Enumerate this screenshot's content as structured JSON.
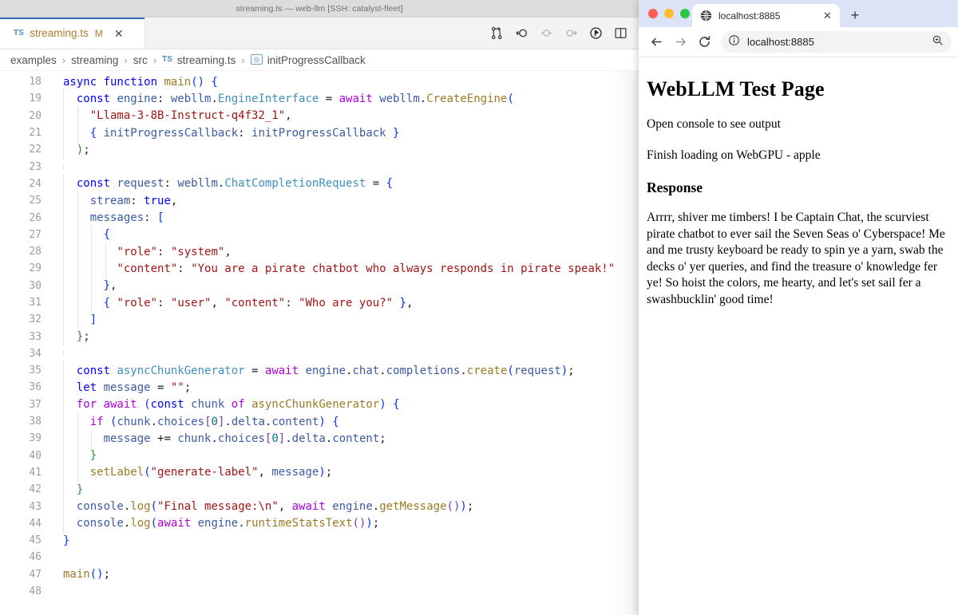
{
  "editor": {
    "window_title": "streaming.ts — web-llm [SSH: catalyst-fleet]",
    "tab": {
      "lang_badge": "TS",
      "filename": "streaming.ts",
      "modified_badge": "M",
      "close_label": "✕"
    },
    "toolbar_icons": [
      "split-changes-icon",
      "previous-change-icon",
      "step-over-icon",
      "step-into-icon",
      "run-icon",
      "split-editor-icon"
    ],
    "breadcrumb": {
      "items": [
        "examples",
        "streaming",
        "src",
        "streaming.ts",
        "initProgressCallback"
      ],
      "separator": "›",
      "file_badge": "TS",
      "symbol_badge": "⬡"
    },
    "first_line_number": 18,
    "lines": [
      {
        "n": 18,
        "guides": 0,
        "tokens": [
          {
            "t": "async ",
            "c": "t-kw"
          },
          {
            "t": "function ",
            "c": "t-kw"
          },
          {
            "t": "main",
            "c": "t-fn"
          },
          {
            "t": "(",
            "c": "b-blue"
          },
          {
            "t": ")",
            "c": "b-blue"
          },
          {
            "t": " ",
            "c": "t-plain"
          },
          {
            "t": "{",
            "c": "b-blue"
          }
        ]
      },
      {
        "n": 19,
        "guides": 1,
        "tokens": [
          {
            "t": "  ",
            "c": "t-plain"
          },
          {
            "t": "const ",
            "c": "t-kw"
          },
          {
            "t": "engine",
            "c": "t-var"
          },
          {
            "t": ": ",
            "c": "t-plain"
          },
          {
            "t": "webllm",
            "c": "t-var"
          },
          {
            "t": ".",
            "c": "t-plain"
          },
          {
            "t": "EngineInterface",
            "c": "t-type"
          },
          {
            "t": " = ",
            "c": "t-plain"
          },
          {
            "t": "await ",
            "c": "t-ctl"
          },
          {
            "t": "webllm",
            "c": "t-var"
          },
          {
            "t": ".",
            "c": "t-plain"
          },
          {
            "t": "CreateEngine",
            "c": "t-fn"
          },
          {
            "t": "(",
            "c": "b-blue"
          }
        ]
      },
      {
        "n": 20,
        "guides": 2,
        "tokens": [
          {
            "t": "    ",
            "c": "t-plain"
          },
          {
            "t": "\"Llama-3-8B-Instruct-q4f32_1\"",
            "c": "t-str"
          },
          {
            "t": ",",
            "c": "t-plain"
          }
        ]
      },
      {
        "n": 21,
        "guides": 2,
        "tokens": [
          {
            "t": "    ",
            "c": "t-plain"
          },
          {
            "t": "{",
            "c": "b-blue"
          },
          {
            "t": " ",
            "c": "t-plain"
          },
          {
            "t": "initProgressCallback",
            "c": "t-var"
          },
          {
            "t": ": ",
            "c": "t-plain"
          },
          {
            "t": "initProgressCallback",
            "c": "t-var"
          },
          {
            "t": " ",
            "c": "t-plain"
          },
          {
            "t": "}",
            "c": "b-blue"
          }
        ]
      },
      {
        "n": 22,
        "guides": 1,
        "tokens": [
          {
            "t": "  ",
            "c": "t-plain"
          },
          {
            "t": ")",
            "c": "b-green"
          },
          {
            "t": ";",
            "c": "t-plain"
          }
        ]
      },
      {
        "n": 23,
        "guides": 1,
        "tokens": []
      },
      {
        "n": 24,
        "guides": 1,
        "tokens": [
          {
            "t": "  ",
            "c": "t-plain"
          },
          {
            "t": "const ",
            "c": "t-kw"
          },
          {
            "t": "request",
            "c": "t-var"
          },
          {
            "t": ": ",
            "c": "t-plain"
          },
          {
            "t": "webllm",
            "c": "t-var"
          },
          {
            "t": ".",
            "c": "t-plain"
          },
          {
            "t": "ChatCompletionRequest",
            "c": "t-type"
          },
          {
            "t": " = ",
            "c": "t-plain"
          },
          {
            "t": "{",
            "c": "b-blue"
          }
        ]
      },
      {
        "n": 25,
        "guides": 2,
        "tokens": [
          {
            "t": "    ",
            "c": "t-plain"
          },
          {
            "t": "stream",
            "c": "t-var"
          },
          {
            "t": ": ",
            "c": "t-plain"
          },
          {
            "t": "true",
            "c": "t-kw"
          },
          {
            "t": ",",
            "c": "t-plain"
          }
        ]
      },
      {
        "n": 26,
        "guides": 2,
        "tokens": [
          {
            "t": "    ",
            "c": "t-plain"
          },
          {
            "t": "messages",
            "c": "t-var"
          },
          {
            "t": ": ",
            "c": "t-plain"
          },
          {
            "t": "[",
            "c": "b-blue"
          }
        ]
      },
      {
        "n": 27,
        "guides": 3,
        "tokens": [
          {
            "t": "      ",
            "c": "t-plain"
          },
          {
            "t": "{",
            "c": "b-blue"
          }
        ]
      },
      {
        "n": 28,
        "guides": 4,
        "tokens": [
          {
            "t": "        ",
            "c": "t-plain"
          },
          {
            "t": "\"role\"",
            "c": "t-str"
          },
          {
            "t": ": ",
            "c": "t-plain"
          },
          {
            "t": "\"system\"",
            "c": "t-str"
          },
          {
            "t": ",",
            "c": "t-plain"
          }
        ]
      },
      {
        "n": 29,
        "guides": 4,
        "tokens": [
          {
            "t": "        ",
            "c": "t-plain"
          },
          {
            "t": "\"content\"",
            "c": "t-str"
          },
          {
            "t": ": ",
            "c": "t-plain"
          },
          {
            "t": "\"You are a pirate chatbot who always responds in pirate speak!\"",
            "c": "t-str"
          }
        ]
      },
      {
        "n": 30,
        "guides": 3,
        "tokens": [
          {
            "t": "      ",
            "c": "t-plain"
          },
          {
            "t": "}",
            "c": "b-blue"
          },
          {
            "t": ",",
            "c": "t-plain"
          }
        ]
      },
      {
        "n": 31,
        "guides": 3,
        "tokens": [
          {
            "t": "      ",
            "c": "t-plain"
          },
          {
            "t": "{",
            "c": "b-blue"
          },
          {
            "t": " ",
            "c": "t-plain"
          },
          {
            "t": "\"role\"",
            "c": "t-str"
          },
          {
            "t": ": ",
            "c": "t-plain"
          },
          {
            "t": "\"user\"",
            "c": "t-str"
          },
          {
            "t": ", ",
            "c": "t-plain"
          },
          {
            "t": "\"content\"",
            "c": "t-str"
          },
          {
            "t": ": ",
            "c": "t-plain"
          },
          {
            "t": "\"Who are you?\"",
            "c": "t-str"
          },
          {
            "t": " ",
            "c": "t-plain"
          },
          {
            "t": "}",
            "c": "b-blue"
          },
          {
            "t": ",",
            "c": "t-plain"
          }
        ]
      },
      {
        "n": 32,
        "guides": 2,
        "tokens": [
          {
            "t": "    ",
            "c": "t-plain"
          },
          {
            "t": "]",
            "c": "b-blue"
          }
        ]
      },
      {
        "n": 33,
        "guides": 1,
        "tokens": [
          {
            "t": "  ",
            "c": "t-plain"
          },
          {
            "t": "}",
            "c": "b-green"
          },
          {
            "t": ";",
            "c": "t-plain"
          }
        ]
      },
      {
        "n": 34,
        "guides": 1,
        "tokens": []
      },
      {
        "n": 35,
        "guides": 1,
        "tokens": [
          {
            "t": "  ",
            "c": "t-plain"
          },
          {
            "t": "const ",
            "c": "t-kw"
          },
          {
            "t": "asyncChunkGenerator",
            "c": "t-type"
          },
          {
            "t": " = ",
            "c": "t-plain"
          },
          {
            "t": "await ",
            "c": "t-ctl"
          },
          {
            "t": "engine",
            "c": "t-var"
          },
          {
            "t": ".",
            "c": "t-plain"
          },
          {
            "t": "chat",
            "c": "t-var"
          },
          {
            "t": ".",
            "c": "t-plain"
          },
          {
            "t": "completions",
            "c": "t-var"
          },
          {
            "t": ".",
            "c": "t-plain"
          },
          {
            "t": "create",
            "c": "t-fn"
          },
          {
            "t": "(",
            "c": "b-blue"
          },
          {
            "t": "request",
            "c": "t-var"
          },
          {
            "t": ")",
            "c": "b-blue"
          },
          {
            "t": ";",
            "c": "t-plain"
          }
        ]
      },
      {
        "n": 36,
        "guides": 1,
        "tokens": [
          {
            "t": "  ",
            "c": "t-plain"
          },
          {
            "t": "let ",
            "c": "t-kw"
          },
          {
            "t": "message",
            "c": "t-var"
          },
          {
            "t": " = ",
            "c": "t-plain"
          },
          {
            "t": "\"\"",
            "c": "t-str"
          },
          {
            "t": ";",
            "c": "t-plain"
          }
        ]
      },
      {
        "n": 37,
        "guides": 1,
        "tokens": [
          {
            "t": "  ",
            "c": "t-plain"
          },
          {
            "t": "for ",
            "c": "t-ctl"
          },
          {
            "t": "await ",
            "c": "t-ctl"
          },
          {
            "t": "(",
            "c": "b-blue"
          },
          {
            "t": "const ",
            "c": "t-kw"
          },
          {
            "t": "chunk",
            "c": "t-var"
          },
          {
            "t": " ",
            "c": "t-plain"
          },
          {
            "t": "of ",
            "c": "t-ctl"
          },
          {
            "t": "asyncChunkGenerator",
            "c": "t-fn"
          },
          {
            "t": ")",
            "c": "b-blue"
          },
          {
            "t": " ",
            "c": "t-plain"
          },
          {
            "t": "{",
            "c": "b-blue"
          }
        ]
      },
      {
        "n": 38,
        "guides": 2,
        "tokens": [
          {
            "t": "    ",
            "c": "t-plain"
          },
          {
            "t": "if ",
            "c": "t-ctl"
          },
          {
            "t": "(",
            "c": "b-blue"
          },
          {
            "t": "chunk",
            "c": "t-var"
          },
          {
            "t": ".",
            "c": "t-plain"
          },
          {
            "t": "choices",
            "c": "t-var"
          },
          {
            "t": "[",
            "c": "b-purp"
          },
          {
            "t": "0",
            "c": "t-num"
          },
          {
            "t": "]",
            "c": "b-purp"
          },
          {
            "t": ".",
            "c": "t-plain"
          },
          {
            "t": "delta",
            "c": "t-var"
          },
          {
            "t": ".",
            "c": "t-plain"
          },
          {
            "t": "content",
            "c": "t-var"
          },
          {
            "t": ")",
            "c": "b-blue"
          },
          {
            "t": " ",
            "c": "t-plain"
          },
          {
            "t": "{",
            "c": "b-blue"
          }
        ]
      },
      {
        "n": 39,
        "guides": 3,
        "tokens": [
          {
            "t": "      ",
            "c": "t-plain"
          },
          {
            "t": "message",
            "c": "t-var"
          },
          {
            "t": " += ",
            "c": "t-plain"
          },
          {
            "t": "chunk",
            "c": "t-var"
          },
          {
            "t": ".",
            "c": "t-plain"
          },
          {
            "t": "choices",
            "c": "t-var"
          },
          {
            "t": "[",
            "c": "b-purp"
          },
          {
            "t": "0",
            "c": "t-num"
          },
          {
            "t": "]",
            "c": "b-purp"
          },
          {
            "t": ".",
            "c": "t-plain"
          },
          {
            "t": "delta",
            "c": "t-var"
          },
          {
            "t": ".",
            "c": "t-plain"
          },
          {
            "t": "content",
            "c": "t-var"
          },
          {
            "t": ";",
            "c": "t-plain"
          }
        ]
      },
      {
        "n": 40,
        "guides": 2,
        "tokens": [
          {
            "t": "    ",
            "c": "t-plain"
          },
          {
            "t": "}",
            "c": "b-green"
          }
        ]
      },
      {
        "n": 41,
        "guides": 2,
        "tokens": [
          {
            "t": "    ",
            "c": "t-plain"
          },
          {
            "t": "setLabel",
            "c": "t-fn"
          },
          {
            "t": "(",
            "c": "b-blue"
          },
          {
            "t": "\"generate-label\"",
            "c": "t-str"
          },
          {
            "t": ", ",
            "c": "t-plain"
          },
          {
            "t": "message",
            "c": "t-var"
          },
          {
            "t": ")",
            "c": "b-blue"
          },
          {
            "t": ";",
            "c": "t-plain"
          }
        ]
      },
      {
        "n": 42,
        "guides": 1,
        "tokens": [
          {
            "t": "  ",
            "c": "t-plain"
          },
          {
            "t": "}",
            "c": "b-green"
          }
        ]
      },
      {
        "n": 43,
        "guides": 1,
        "tokens": [
          {
            "t": "  ",
            "c": "t-plain"
          },
          {
            "t": "console",
            "c": "t-var"
          },
          {
            "t": ".",
            "c": "t-plain"
          },
          {
            "t": "log",
            "c": "t-fn"
          },
          {
            "t": "(",
            "c": "b-blue"
          },
          {
            "t": "\"Final message:\\n\"",
            "c": "t-str"
          },
          {
            "t": ", ",
            "c": "t-plain"
          },
          {
            "t": "await ",
            "c": "t-ctl"
          },
          {
            "t": "engine",
            "c": "t-var"
          },
          {
            "t": ".",
            "c": "t-plain"
          },
          {
            "t": "getMessage",
            "c": "t-fn"
          },
          {
            "t": "(",
            "c": "b-purp"
          },
          {
            "t": ")",
            "c": "b-purp"
          },
          {
            "t": ")",
            "c": "b-blue"
          },
          {
            "t": ";",
            "c": "t-plain"
          }
        ]
      },
      {
        "n": 44,
        "guides": 1,
        "tokens": [
          {
            "t": "  ",
            "c": "t-plain"
          },
          {
            "t": "console",
            "c": "t-var"
          },
          {
            "t": ".",
            "c": "t-plain"
          },
          {
            "t": "log",
            "c": "t-fn"
          },
          {
            "t": "(",
            "c": "b-blue"
          },
          {
            "t": "await ",
            "c": "t-ctl"
          },
          {
            "t": "engine",
            "c": "t-var"
          },
          {
            "t": ".",
            "c": "t-plain"
          },
          {
            "t": "runtimeStatsText",
            "c": "t-fn"
          },
          {
            "t": "(",
            "c": "b-purp"
          },
          {
            "t": ")",
            "c": "b-purp"
          },
          {
            "t": ")",
            "c": "b-blue"
          },
          {
            "t": ";",
            "c": "t-plain"
          }
        ]
      },
      {
        "n": 45,
        "guides": 0,
        "tokens": [
          {
            "t": "}",
            "c": "b-blue"
          }
        ]
      },
      {
        "n": 46,
        "guides": 0,
        "tokens": []
      },
      {
        "n": 47,
        "guides": 0,
        "tokens": [
          {
            "t": "main",
            "c": "t-fn"
          },
          {
            "t": "(",
            "c": "b-blue"
          },
          {
            "t": ")",
            "c": "b-blue"
          },
          {
            "t": ";",
            "c": "t-plain"
          }
        ]
      },
      {
        "n": 48,
        "guides": 0,
        "tokens": []
      }
    ]
  },
  "browser": {
    "traffic_lights": [
      "#ff5f57",
      "#febc2e",
      "#28c840"
    ],
    "tab": {
      "title": "localhost:8885",
      "favicon": "globe-icon",
      "close_label": "✕"
    },
    "new_tab_label": "+",
    "nav": {
      "back_label": "←",
      "forward_label": "→",
      "reload_label": "⟳"
    },
    "omnibox": {
      "info_icon": "site-info-icon",
      "url": "localhost:8885",
      "zoom_icon": "zoom-icon"
    },
    "page": {
      "title": "WebLLM Test Page",
      "console_hint": "Open console to see output",
      "status": "Finish loading on WebGPU - apple",
      "response_heading": "Response",
      "response_text": "Arrrr, shiver me timbers! I be Captain Chat, the scurviest pirate chatbot to ever sail the Seven Seas o' Cyberspace! Me and me trusty keyboard be ready to spin ye a yarn, swab the decks o' yer queries, and find the treasure o' knowledge fer ye! So hoist the colors, me hearty, and let's set sail fer a swashbucklin' good time!"
    }
  }
}
